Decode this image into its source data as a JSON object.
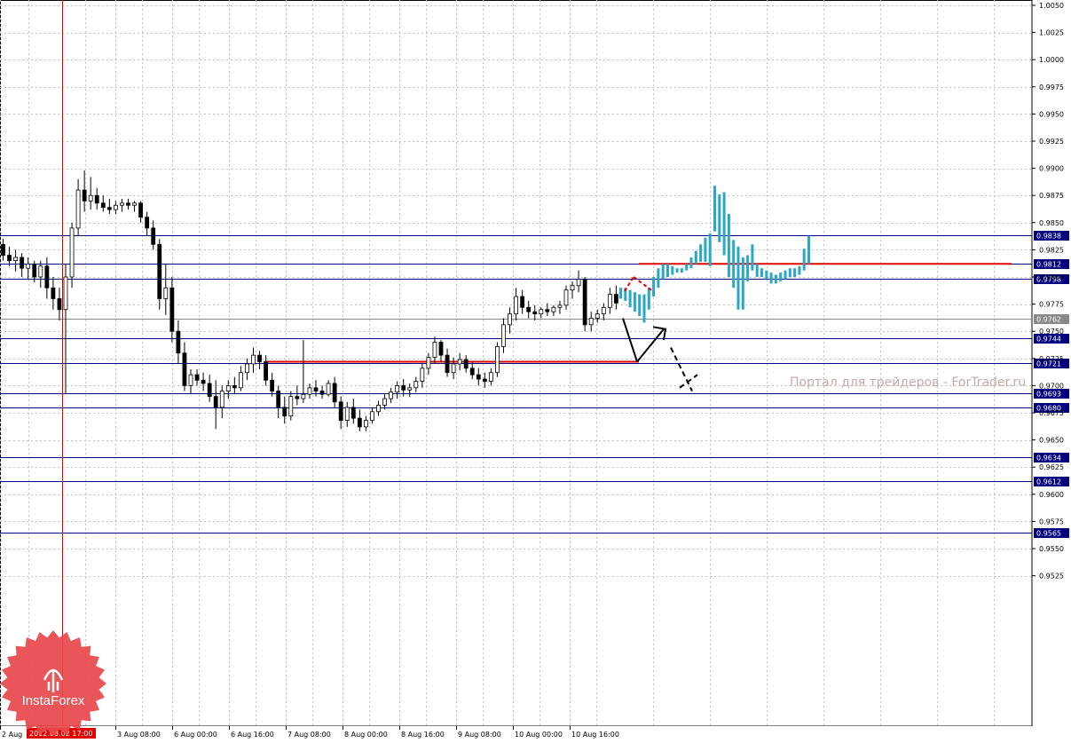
{
  "chart_data": {
    "type": "candlestick",
    "y_ticks": [
      "1.0050",
      "1.0025",
      "1.0000",
      "0.9975",
      "0.9950",
      "0.9925",
      "0.9900",
      "0.9875",
      "0.9850",
      "0.9825",
      "0.9800",
      "0.9775",
      "0.9750",
      "0.9725",
      "0.9700",
      "0.9675",
      "0.9650",
      "0.9625",
      "0.9600",
      "0.9575",
      "0.9550",
      "0.9525"
    ],
    "ylim": [
      0.9515,
      1.0055
    ],
    "x_ticks": [
      "2 Aug",
      "3 Aug 08:00",
      "6 Aug 00:00",
      "6 Aug 16:00",
      "7 Aug 08:00",
      "8 Aug 00:00",
      "8 Aug 16:00",
      "9 Aug 08:00",
      "10 Aug 00:00",
      "10 Aug 16:00"
    ],
    "crosshair_time_label": "2012.08.02 17:00",
    "grid": true,
    "levels": [
      {
        "value": 0.9838,
        "label": "0.9838",
        "color": "#000080"
      },
      {
        "value": 0.9812,
        "label": "0.9812",
        "color": "#000080"
      },
      {
        "value": 0.9798,
        "label": "0.9798",
        "color": "#000080"
      },
      {
        "value": 0.9762,
        "label": "0.9762",
        "color": "#888888"
      },
      {
        "value": 0.9744,
        "label": "0.9744",
        "color": "#000080"
      },
      {
        "value": 0.9721,
        "label": "0.9721",
        "color": "#000080"
      },
      {
        "value": 0.9693,
        "label": "0.9693",
        "color": "#000080"
      },
      {
        "value": 0.968,
        "label": "0.9680",
        "color": "#000080"
      },
      {
        "value": 0.9634,
        "label": "0.9634",
        "color": "#000080"
      },
      {
        "value": 0.9612,
        "label": "0.9612",
        "color": "#000080"
      },
      {
        "value": 0.9565,
        "label": "0.9565",
        "color": "#000080"
      }
    ],
    "red_lines": [
      {
        "x_from": 300,
        "x_to": 720,
        "value": 0.9722
      },
      {
        "x_from": 720,
        "x_to": 1140,
        "value": 0.9812
      }
    ],
    "candles": [
      [
        0.983,
        0.9835,
        0.9815,
        0.982
      ],
      [
        0.982,
        0.9828,
        0.981,
        0.9815
      ],
      [
        0.9815,
        0.9825,
        0.9805,
        0.9818
      ],
      [
        0.9818,
        0.9822,
        0.98,
        0.9808
      ],
      [
        0.9808,
        0.9818,
        0.9798,
        0.9812
      ],
      [
        0.9812,
        0.9815,
        0.9795,
        0.98
      ],
      [
        0.98,
        0.9815,
        0.979,
        0.981
      ],
      [
        0.981,
        0.9818,
        0.978,
        0.979
      ],
      [
        0.979,
        0.98,
        0.977,
        0.978
      ],
      [
        0.978,
        0.979,
        0.976,
        0.977
      ],
      [
        0.977,
        0.9812,
        0.9693,
        0.98
      ],
      [
        0.98,
        0.985,
        0.979,
        0.9845
      ],
      [
        0.9845,
        0.989,
        0.9838,
        0.988
      ],
      [
        0.988,
        0.9898,
        0.986,
        0.987
      ],
      [
        0.987,
        0.9892,
        0.9862,
        0.9875
      ],
      [
        0.9875,
        0.9882,
        0.9862,
        0.9868
      ],
      [
        0.9868,
        0.9875,
        0.986,
        0.9864
      ],
      [
        0.9864,
        0.9872,
        0.9858,
        0.9862
      ],
      [
        0.9862,
        0.987,
        0.9858,
        0.9866
      ],
      [
        0.9866,
        0.9872,
        0.986,
        0.9868
      ],
      [
        0.9868,
        0.9872,
        0.9862,
        0.9866
      ],
      [
        0.9866,
        0.987,
        0.986,
        0.9868
      ],
      [
        0.9868,
        0.987,
        0.985,
        0.9855
      ],
      [
        0.9855,
        0.986,
        0.9838,
        0.9845
      ],
      [
        0.9845,
        0.9852,
        0.9825,
        0.983
      ],
      [
        0.983,
        0.9835,
        0.977,
        0.978
      ],
      [
        0.978,
        0.9812,
        0.9765,
        0.979
      ],
      [
        0.979,
        0.98,
        0.974,
        0.975
      ],
      [
        0.975,
        0.976,
        0.972,
        0.973
      ],
      [
        0.973,
        0.974,
        0.9695,
        0.97
      ],
      [
        0.97,
        0.9715,
        0.9693,
        0.971
      ],
      [
        0.971,
        0.9715,
        0.97,
        0.9705
      ],
      [
        0.9705,
        0.9712,
        0.9695,
        0.9702
      ],
      [
        0.9702,
        0.971,
        0.9685,
        0.969
      ],
      [
        0.969,
        0.9705,
        0.966,
        0.968
      ],
      [
        0.968,
        0.97,
        0.967,
        0.9695
      ],
      [
        0.9695,
        0.9705,
        0.9688,
        0.97
      ],
      [
        0.97,
        0.9708,
        0.9692,
        0.9698
      ],
      [
        0.9698,
        0.9718,
        0.9695,
        0.9712
      ],
      [
        0.9712,
        0.9725,
        0.9705,
        0.972
      ],
      [
        0.972,
        0.9735,
        0.9712,
        0.9728
      ],
      [
        0.9728,
        0.9732,
        0.9715,
        0.9722
      ],
      [
        0.9722,
        0.9728,
        0.97,
        0.9705
      ],
      [
        0.9705,
        0.9712,
        0.969,
        0.9695
      ],
      [
        0.9695,
        0.97,
        0.967,
        0.968
      ],
      [
        0.968,
        0.969,
        0.9665,
        0.9672
      ],
      [
        0.9672,
        0.9695,
        0.9668,
        0.969
      ],
      [
        0.969,
        0.97,
        0.9682,
        0.9688
      ],
      [
        0.9688,
        0.9742,
        0.9684,
        0.9692
      ],
      [
        0.9692,
        0.9702,
        0.9688,
        0.9698
      ],
      [
        0.9698,
        0.9705,
        0.969,
        0.9695
      ],
      [
        0.9695,
        0.97,
        0.9688,
        0.9692
      ],
      [
        0.9692,
        0.9705,
        0.969,
        0.9702
      ],
      [
        0.9702,
        0.9708,
        0.968,
        0.9685
      ],
      [
        0.9685,
        0.969,
        0.966,
        0.9668
      ],
      [
        0.9668,
        0.9685,
        0.9662,
        0.968
      ],
      [
        0.968,
        0.9688,
        0.9665,
        0.967
      ],
      [
        0.967,
        0.9678,
        0.9658,
        0.9662
      ],
      [
        0.9662,
        0.9672,
        0.9658,
        0.9668
      ],
      [
        0.9668,
        0.968,
        0.9665,
        0.9676
      ],
      [
        0.9676,
        0.9686,
        0.9672,
        0.9682
      ],
      [
        0.9682,
        0.9692,
        0.9678,
        0.9688
      ],
      [
        0.9688,
        0.9698,
        0.9684,
        0.9694
      ],
      [
        0.9694,
        0.9704,
        0.9688,
        0.97
      ],
      [
        0.97,
        0.9706,
        0.969,
        0.9696
      ],
      [
        0.9696,
        0.9702,
        0.969,
        0.9698
      ],
      [
        0.9698,
        0.9708,
        0.9694,
        0.9704
      ],
      [
        0.9704,
        0.972,
        0.9698,
        0.9716
      ],
      [
        0.9716,
        0.973,
        0.971,
        0.9726
      ],
      [
        0.9726,
        0.9745,
        0.972,
        0.974
      ],
      [
        0.974,
        0.9742,
        0.9722,
        0.9728
      ],
      [
        0.9728,
        0.9734,
        0.9708,
        0.9712
      ],
      [
        0.9712,
        0.9726,
        0.9706,
        0.972
      ],
      [
        0.972,
        0.973,
        0.9714,
        0.9724
      ],
      [
        0.9724,
        0.9728,
        0.9712,
        0.9716
      ],
      [
        0.9716,
        0.9722,
        0.9706,
        0.971
      ],
      [
        0.971,
        0.9716,
        0.97,
        0.9706
      ],
      [
        0.9706,
        0.9712,
        0.9698,
        0.9704
      ],
      [
        0.9704,
        0.9716,
        0.97,
        0.9712
      ],
      [
        0.9712,
        0.974,
        0.9708,
        0.9736
      ],
      [
        0.9736,
        0.9762,
        0.973,
        0.9756
      ],
      [
        0.9756,
        0.9772,
        0.9748,
        0.9766
      ],
      [
        0.9766,
        0.979,
        0.976,
        0.9782
      ],
      [
        0.9782,
        0.9788,
        0.9766,
        0.9772
      ],
      [
        0.9772,
        0.9778,
        0.9762,
        0.9768
      ],
      [
        0.9768,
        0.9774,
        0.976,
        0.9766
      ],
      [
        0.9766,
        0.9772,
        0.9762,
        0.977
      ],
      [
        0.977,
        0.9776,
        0.9764,
        0.9768
      ],
      [
        0.9768,
        0.9774,
        0.9764,
        0.9772
      ],
      [
        0.9772,
        0.9778,
        0.9766,
        0.9774
      ],
      [
        0.9774,
        0.9792,
        0.977,
        0.9788
      ],
      [
        0.9788,
        0.9796,
        0.978,
        0.9792
      ],
      [
        0.9792,
        0.9806,
        0.9786,
        0.9798
      ],
      [
        0.9798,
        0.98,
        0.975,
        0.9756
      ],
      [
        0.9756,
        0.9768,
        0.975,
        0.9762
      ],
      [
        0.9762,
        0.977,
        0.9758,
        0.9766
      ],
      [
        0.9766,
        0.9776,
        0.976,
        0.9772
      ],
      [
        0.9772,
        0.979,
        0.9766,
        0.9784
      ],
      [
        0.9784,
        0.9792,
        0.977,
        0.9776
      ]
    ],
    "projection_bars": [
      [
        0.979,
        0.978
      ],
      [
        0.979,
        0.9778
      ],
      [
        0.9788,
        0.9772
      ],
      [
        0.9786,
        0.9768
      ],
      [
        0.9784,
        0.9764
      ],
      [
        0.9784,
        0.9758
      ],
      [
        0.979,
        0.977
      ],
      [
        0.98,
        0.9782
      ],
      [
        0.9808,
        0.979
      ],
      [
        0.9812,
        0.9798
      ],
      [
        0.9812,
        0.98
      ],
      [
        0.981,
        0.9802
      ],
      [
        0.9808,
        0.9804
      ],
      [
        0.9808,
        0.9804
      ],
      [
        0.9812,
        0.9806
      ],
      [
        0.9818,
        0.9808
      ],
      [
        0.9824,
        0.9812
      ],
      [
        0.983,
        0.9814
      ],
      [
        0.9836,
        0.9814
      ],
      [
        0.984,
        0.981
      ],
      [
        0.9884,
        0.9842
      ],
      [
        0.9876,
        0.9832
      ],
      [
        0.9878,
        0.982
      ],
      [
        0.9858,
        0.98
      ],
      [
        0.9834,
        0.979
      ],
      [
        0.9828,
        0.977
      ],
      [
        0.9818,
        0.977
      ],
      [
        0.982,
        0.9796
      ],
      [
        0.983,
        0.9806
      ],
      [
        0.9812,
        0.98
      ],
      [
        0.9808,
        0.98
      ],
      [
        0.9806,
        0.9798
      ],
      [
        0.9804,
        0.9794
      ],
      [
        0.9802,
        0.9794
      ],
      [
        0.9804,
        0.9796
      ],
      [
        0.9806,
        0.9798
      ],
      [
        0.9808,
        0.98
      ],
      [
        0.9808,
        0.98
      ],
      [
        0.981,
        0.9802
      ],
      [
        0.9826,
        0.9806
      ],
      [
        0.9838,
        0.9812
      ]
    ],
    "arrows": {
      "black_solid": [
        [
          0.9762,
          0.9722
        ],
        [
          0.9722,
          0.9752
        ]
      ],
      "black_dashed": [
        [
          0.9735,
          0.9695
        ],
        [
          0.9695,
          0.971
        ]
      ],
      "red_dashed": [
        [
          0.9787,
          0.98
        ],
        [
          0.98,
          0.9788
        ]
      ]
    }
  },
  "watermark": "Портал для трейдеров - ForTrader.ru",
  "brand": {
    "name": "InstaForex",
    "color": "#e8474c"
  }
}
